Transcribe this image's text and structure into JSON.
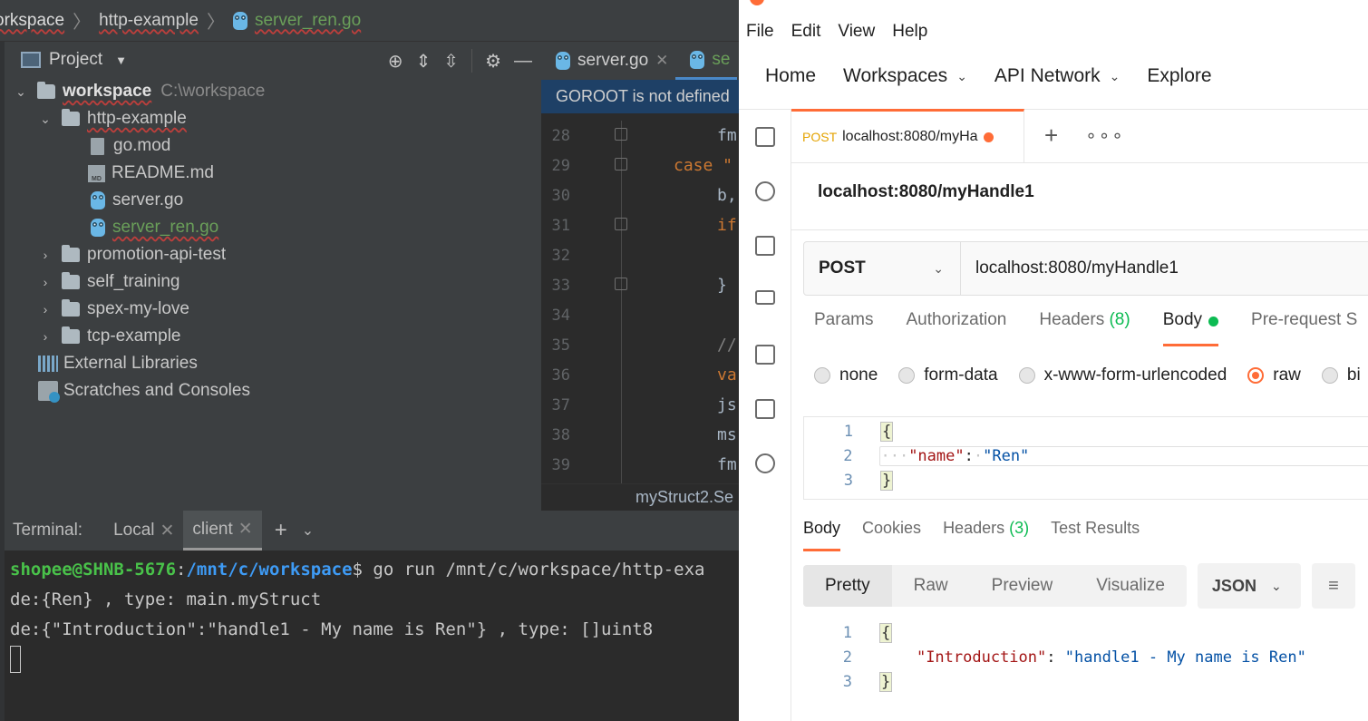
{
  "ide": {
    "breadcrumb": [
      "orkspace",
      "http-example",
      "server_ren.go"
    ],
    "project_panel": {
      "title": "Project",
      "tree": [
        {
          "label": "workspace",
          "hint": "C:\\workspace"
        },
        {
          "label": "http-example"
        },
        {
          "label": "go.mod"
        },
        {
          "label": "README.md"
        },
        {
          "label": "server.go"
        },
        {
          "label": "server_ren.go"
        },
        {
          "label": "promotion-api-test"
        },
        {
          "label": "self_training"
        },
        {
          "label": "spex-my-love"
        },
        {
          "label": "tcp-example"
        },
        {
          "label": "External Libraries"
        },
        {
          "label": "Scratches and Consoles"
        }
      ]
    },
    "editor": {
      "tabs": [
        {
          "label": "server.go"
        },
        {
          "label": "se"
        }
      ],
      "banner": "GOROOT is not defined",
      "lines": [
        {
          "num": "28",
          "text": "fm"
        },
        {
          "num": "29",
          "text": "case \""
        },
        {
          "num": "30",
          "text": "b,"
        },
        {
          "num": "31",
          "text": "if"
        },
        {
          "num": "32",
          "text": ""
        },
        {
          "num": "33",
          "text": "}"
        },
        {
          "num": "34",
          "text": ""
        },
        {
          "num": "35",
          "text": "//"
        },
        {
          "num": "36",
          "text": "va"
        },
        {
          "num": "37",
          "text": "js"
        },
        {
          "num": "38",
          "text": "ms"
        },
        {
          "num": "39",
          "text": "fm"
        }
      ],
      "hint": "myStruct2.Se"
    },
    "terminal": {
      "title": "Terminal:",
      "tabs": [
        "Local",
        "client"
      ],
      "prompt_user": "shopee@SHNB-5676",
      "prompt_path": "/mnt/c/workspace",
      "command": "$ go run /mnt/c/workspace/http-exa",
      "output": [
        "de:{Ren} , type: main.myStruct",
        "de:{\"Introduction\":\"handle1 - My name is Ren\"} , type: []uint8"
      ]
    }
  },
  "postman": {
    "menu": [
      "File",
      "Edit",
      "View",
      "Help"
    ],
    "nav": [
      "Home",
      "Workspaces",
      "API Network",
      "Explore"
    ],
    "request_tab": {
      "method": "POST",
      "name": "localhost:8080/myHa"
    },
    "request_title": "localhost:8080/myHandle1",
    "method": "POST",
    "url": "localhost:8080/myHandle1",
    "param_tabs": {
      "params": "Params",
      "authorization": "Authorization",
      "headers": "Headers",
      "headers_count": "(8)",
      "body": "Body",
      "prerequest": "Pre-request S"
    },
    "body_types": [
      "none",
      "form-data",
      "x-www-form-urlencoded",
      "raw",
      "bi"
    ],
    "request_body": {
      "lines": [
        "1",
        "2",
        "3"
      ],
      "key": "\"name\"",
      "value": "\"Ren\""
    },
    "response_tabs": {
      "body": "Body",
      "cookies": "Cookies",
      "headers": "Headers",
      "headers_count": "(3)",
      "tests": "Test Results"
    },
    "view_modes": [
      "Pretty",
      "Raw",
      "Preview",
      "Visualize"
    ],
    "format": "JSON",
    "response_body": {
      "lines": [
        "1",
        "2",
        "3"
      ],
      "key": "\"Introduction\"",
      "value": "\"handle1 - My name is Ren\""
    },
    "colors": {
      "accent": "#ff6c37",
      "green": "#0cbb52"
    }
  }
}
